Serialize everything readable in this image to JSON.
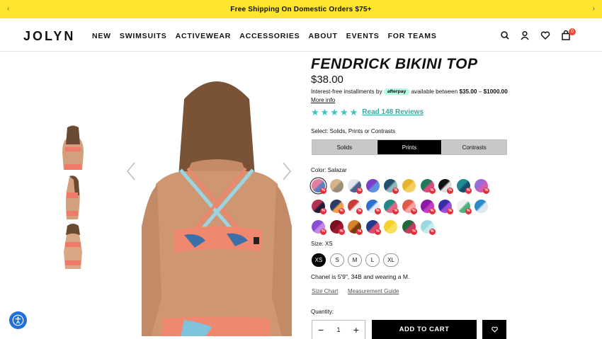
{
  "promo": {
    "text": "Free Shipping On Domestic Orders $75+"
  },
  "header": {
    "logo": "JOLYN",
    "nav": [
      "NEW",
      "SWIMSUITS",
      "ACTIVEWEAR",
      "ACCESSORIES",
      "ABOUT",
      "EVENTS",
      "FOR TEAMS"
    ],
    "cart_count": "0",
    "icons": [
      "search-icon",
      "account-icon",
      "heart-icon",
      "bag-icon"
    ]
  },
  "product": {
    "title": "FENDRICK BIKINI TOP",
    "price": "$38.00",
    "afterpay": {
      "prefix": "Interest-free installments by",
      "logo": "afterpay",
      "middle": "available between",
      "min": "$35.00",
      "dash": "–",
      "max": "$1000.00",
      "more": "More info"
    },
    "rating": 5,
    "reviews": "Read 148 Reviews",
    "select_label": "Select: Solids, Prints or Contrasts",
    "tabs": [
      "Solids",
      "Prints",
      "Contrasts"
    ],
    "active_tab": "Prints",
    "color_label": "Color: Salazar",
    "swatches": [
      {
        "c1": "#e57ea2",
        "c2": "#5b7fc4",
        "pct": true,
        "selected": true
      },
      {
        "c1": "#d6b48a",
        "c2": "#9c8f7a",
        "pct": false
      },
      {
        "c1": "#e4e8ee",
        "c2": "#4f5f8c",
        "pct": true
      },
      {
        "c1": "#7a3fc8",
        "c2": "#5f8de0",
        "pct": false
      },
      {
        "c1": "#22506a",
        "c2": "#8fb7c0",
        "pct": true
      },
      {
        "c1": "#e6b52c",
        "c2": "#f2d060",
        "pct": false
      },
      {
        "c1": "#1f7a58",
        "c2": "#d84a80",
        "pct": true
      },
      {
        "c1": "#111111",
        "c2": "#dddddd",
        "pct": true
      },
      {
        "c1": "#1e8c8f",
        "c2": "#144e6d",
        "pct": true
      },
      {
        "c1": "#9a6ad6",
        "c2": "#d25fb2",
        "pct": true
      },
      {
        "c1": "#b2324f",
        "c2": "#1f1f3a",
        "pct": true
      },
      {
        "c1": "#2b3b66",
        "c2": "#f0a04a",
        "pct": true
      },
      {
        "c1": "#c93b3b",
        "c2": "#f0f0f0",
        "pct": true
      },
      {
        "c1": "#2f6fcf",
        "c2": "#e6edf7",
        "pct": true
      },
      {
        "c1": "#1e8a80",
        "c2": "#e06a8a",
        "pct": true
      },
      {
        "c1": "#e05a4a",
        "c2": "#f5a5a5",
        "pct": true
      },
      {
        "c1": "#8a1aa6",
        "c2": "#c23cc6",
        "pct": true
      },
      {
        "c1": "#3a2aa8",
        "c2": "#9a4fd6",
        "pct": true
      },
      {
        "c1": "#f0f0f0",
        "c2": "#4ab27a",
        "pct": true
      },
      {
        "c1": "#2a8ac6",
        "c2": "#dde6f2",
        "pct": false
      },
      {
        "c1": "#8a4fd0",
        "c2": "#c08ae6",
        "pct": true
      },
      {
        "c1": "#7a0f1f",
        "c2": "#a01a2f",
        "pct": true
      },
      {
        "c1": "#d8832c",
        "c2": "#7a3a12",
        "pct": true
      },
      {
        "c1": "#1f3a8a",
        "c2": "#e04a6a",
        "pct": true
      },
      {
        "c1": "#f4d22a",
        "c2": "#f7e060",
        "pct": false
      },
      {
        "c1": "#1e6a3a",
        "c2": "#c93b5f",
        "pct": true
      },
      {
        "c1": "#9ad8e0",
        "c2": "#c6ecef",
        "pct": true
      }
    ],
    "size_label": "Size: XS",
    "sizes": [
      "XS",
      "S",
      "M",
      "L",
      "XL"
    ],
    "selected_size": "XS",
    "model_note": "Chanel is 5'9\", 34B and wearing a M.",
    "size_chart": "Size Chart",
    "measurement_guide": "Measurement Guide",
    "quantity_label": "Quantity:",
    "quantity": "1",
    "add_to_cart": "ADD TO CART"
  }
}
